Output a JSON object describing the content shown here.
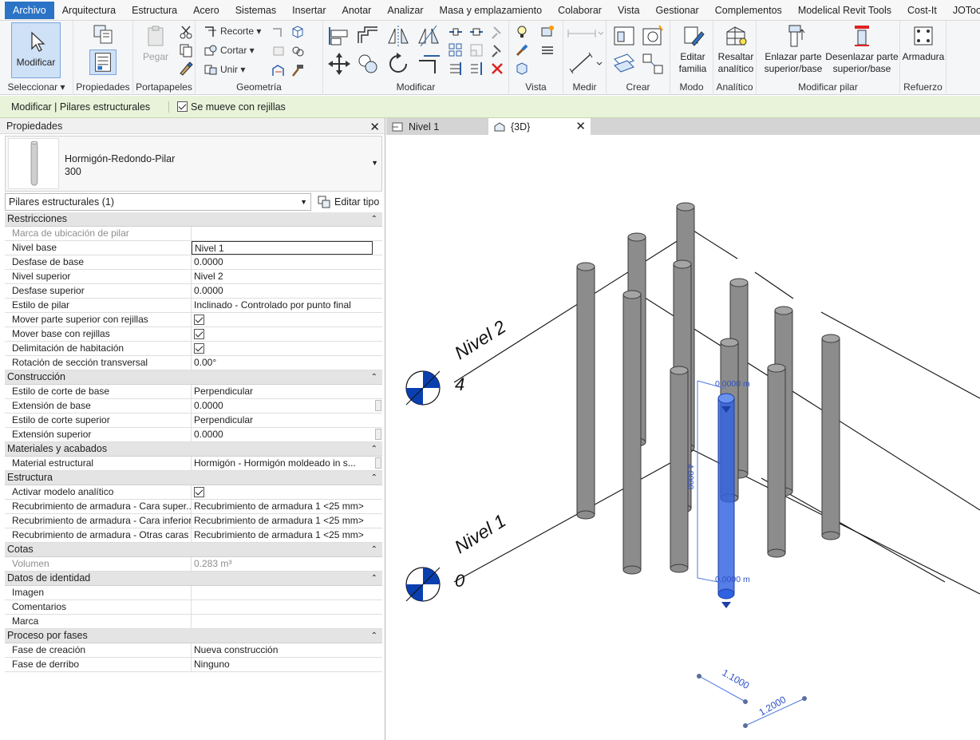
{
  "menu": [
    "Archivo",
    "Arquitectura",
    "Estructura",
    "Acero",
    "Sistemas",
    "Insertar",
    "Anotar",
    "Analizar",
    "Masa y emplazamiento",
    "Colaborar",
    "Vista",
    "Gestionar",
    "Complementos",
    "Modelical Revit Tools",
    "Cost-It",
    "JOTools"
  ],
  "ribbon": {
    "modify_label": "Modificar",
    "select_label": "Seleccionar ▾",
    "properties_label": "Propiedades",
    "clipboard": {
      "paste": "Pegar",
      "label": "Portapapeles"
    },
    "geometry": {
      "recorte": "Recorte",
      "cortar": "Cortar",
      "unir": "Unir",
      "label": "Geometría"
    },
    "modify_panel_label": "Modificar",
    "view_label": "Vista",
    "measure_label": "Medir",
    "create_label": "Crear",
    "mode": {
      "button": "Editar familia",
      "label": "Modo"
    },
    "analytic": {
      "button": "Resaltar analítico",
      "label": "Analítico"
    },
    "pillar": {
      "attach": "Enlazar parte superior/base",
      "detach": "Desenlazar parte superior/base",
      "label": "Modificar pilar"
    },
    "rebar": {
      "button": "Armadura",
      "label": "Refuerzo"
    }
  },
  "context_bar": {
    "label": "Modificar | Pilares estructurales",
    "checkbox_label": "Se mueve con rejillas"
  },
  "properties": {
    "title": "Propiedades",
    "type_name_line1": "Hormigón-Redondo-Pilar",
    "type_name_line2": "300",
    "filter": "Pilares estructurales (1)",
    "edit_type": "Editar tipo",
    "groups": [
      {
        "name": "Restricciones",
        "rows": [
          {
            "k": "Marca de ubicación de pilar",
            "v": "",
            "dim": true
          },
          {
            "k": "Nivel base",
            "v": "Nivel 1",
            "edit": true
          },
          {
            "k": "Desfase de base",
            "v": "0.0000"
          },
          {
            "k": "Nivel superior",
            "v": "Nivel 2"
          },
          {
            "k": "Desfase superior",
            "v": "0.0000"
          },
          {
            "k": "Estilo de pilar",
            "v": "Inclinado - Controlado por punto final"
          },
          {
            "k": "Mover parte superior con rejillas",
            "check": true
          },
          {
            "k": "Mover base con rejillas",
            "check": true
          },
          {
            "k": "Delimitación de habitación",
            "check": true
          },
          {
            "k": "Rotación de sección transversal",
            "v": "0.00°"
          }
        ]
      },
      {
        "name": "Construcción",
        "rows": [
          {
            "k": "Estilo de corte de base",
            "v": "Perpendicular"
          },
          {
            "k": "Extensión de base",
            "v": "0.0000",
            "scroll": true
          },
          {
            "k": "Estilo de corte superior",
            "v": "Perpendicular"
          },
          {
            "k": "Extensión superior",
            "v": "0.0000",
            "scroll": true
          }
        ]
      },
      {
        "name": "Materiales y acabados",
        "rows": [
          {
            "k": "Material estructural",
            "v": "Hormigón - Hormigón moldeado in s...",
            "scroll": true
          }
        ]
      },
      {
        "name": "Estructura",
        "rows": [
          {
            "k": "Activar modelo analítico",
            "check": true
          },
          {
            "k": "Recubrimiento de armadura - Cara super...",
            "v": "Recubrimiento de armadura 1 <25 mm>"
          },
          {
            "k": "Recubrimiento de armadura - Cara inferior",
            "v": "Recubrimiento de armadura 1 <25 mm>"
          },
          {
            "k": "Recubrimiento de armadura - Otras caras",
            "v": "Recubrimiento de armadura 1 <25 mm>"
          }
        ]
      },
      {
        "name": "Cotas",
        "rows": [
          {
            "k": "Volumen",
            "v": "0.283 m³",
            "dim": true
          }
        ]
      },
      {
        "name": "Datos de identidad",
        "rows": [
          {
            "k": "Imagen",
            "v": ""
          },
          {
            "k": "Comentarios",
            "v": ""
          },
          {
            "k": "Marca",
            "v": ""
          }
        ]
      },
      {
        "name": "Proceso por fases",
        "rows": [
          {
            "k": "Fase de creación",
            "v": "Nueva construcción"
          },
          {
            "k": "Fase de derribo",
            "v": "Ninguno"
          }
        ]
      }
    ]
  },
  "tabs": [
    {
      "label": "Nivel 1"
    },
    {
      "label": "{3D}"
    }
  ],
  "viewport": {
    "level_top_name": "Nivel 2",
    "level_top_elev": "4",
    "level_bottom_name": "Nivel 1",
    "level_bottom_elev": "0",
    "top_offset": "0.0000 m",
    "bottom_offset": "0.0000 m",
    "height_dim": "4.0000",
    "dim_a": "1.1000",
    "dim_b": "1.2000",
    "selection_color": "#2f62e0",
    "column_color": "#8c8c8c"
  }
}
